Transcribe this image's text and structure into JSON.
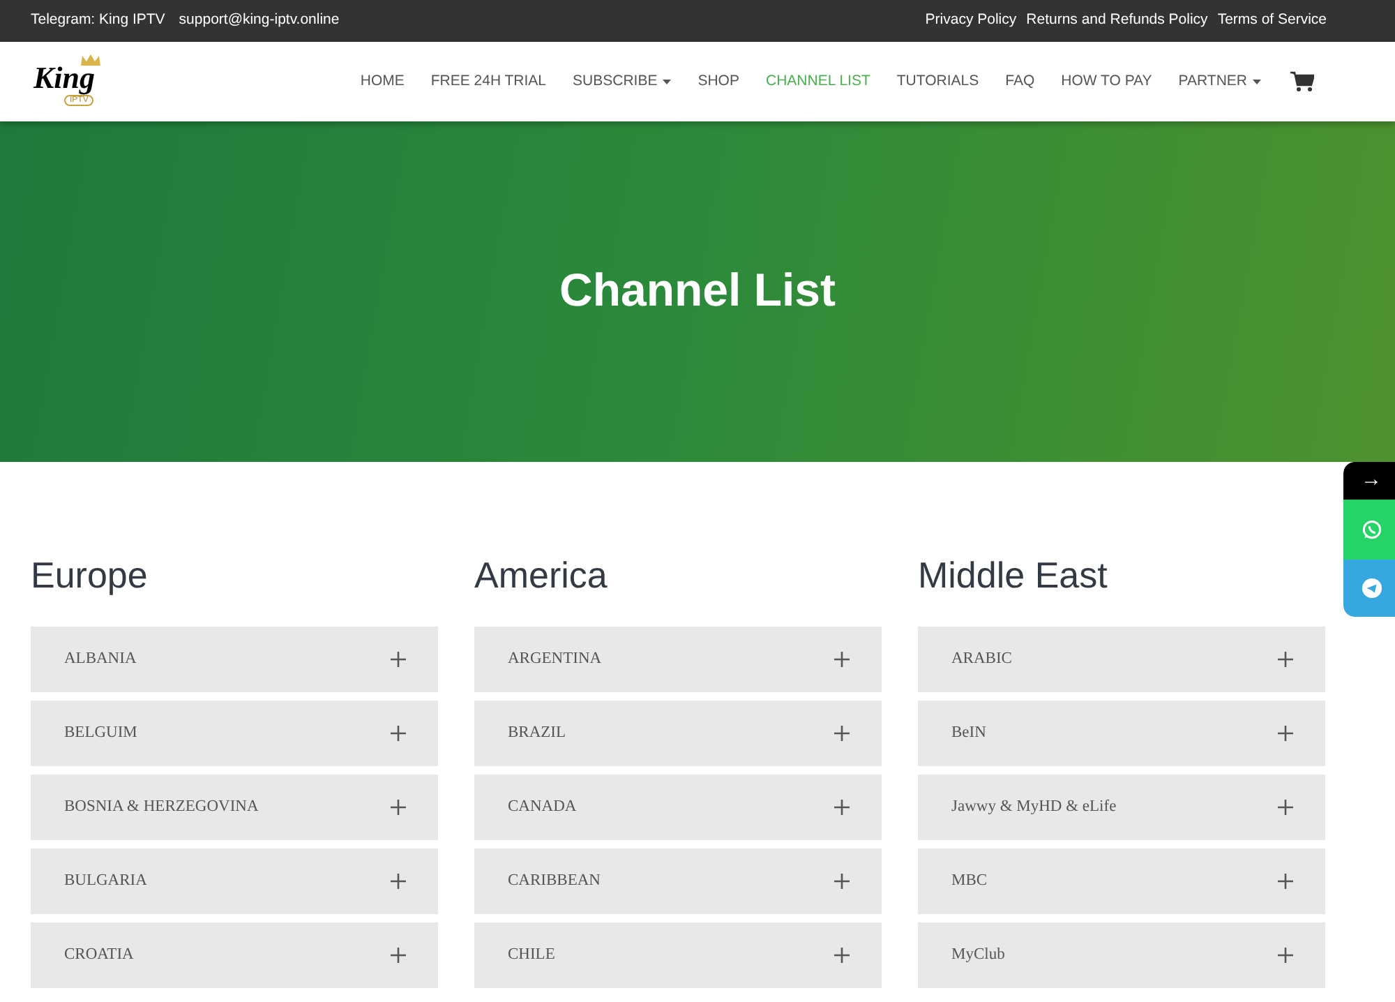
{
  "topbar": {
    "left": [
      "Telegram: King IPTV",
      "support@king-iptv.online"
    ],
    "right": [
      "Privacy Policy",
      "Returns and Refunds Policy",
      "Terms of Service"
    ]
  },
  "logo": {
    "word": "King",
    "sub": "IPTV"
  },
  "nav": [
    {
      "label": "HOME",
      "selected": false,
      "dropdown": false
    },
    {
      "label": "FREE 24H TRIAL",
      "selected": false,
      "dropdown": false
    },
    {
      "label": "SUBSCRIBE",
      "selected": false,
      "dropdown": true
    },
    {
      "label": "SHOP",
      "selected": false,
      "dropdown": false
    },
    {
      "label": "CHANNEL LIST",
      "selected": true,
      "dropdown": false
    },
    {
      "label": "TUTORIALS",
      "selected": false,
      "dropdown": false
    },
    {
      "label": "FAQ",
      "selected": false,
      "dropdown": false
    },
    {
      "label": "HOW TO PAY",
      "selected": false,
      "dropdown": false
    },
    {
      "label": "PARTNER",
      "selected": false,
      "dropdown": true
    }
  ],
  "hero": {
    "title": "Channel List"
  },
  "side_buttons": [
    {
      "kind": "arrow",
      "label": "→"
    },
    {
      "kind": "whatsapp"
    },
    {
      "kind": "telegram"
    }
  ],
  "regions": [
    {
      "title": "Europe",
      "items": [
        {
          "label": "ALBANIA",
          "expanded": false
        },
        {
          "label": "BELGUIM",
          "expanded": false
        },
        {
          "label": "BOSNIA & HERZEGOVINA",
          "expanded": false
        },
        {
          "label": "BULGARIA",
          "expanded": false
        },
        {
          "label": "CROATIA",
          "expanded": false
        }
      ]
    },
    {
      "title": "America",
      "items": [
        {
          "label": "ARGENTINA",
          "expanded": false
        },
        {
          "label": "BRAZIL",
          "expanded": false
        },
        {
          "label": "CANADA",
          "expanded": false
        },
        {
          "label": "CARIBBEAN",
          "expanded": false
        },
        {
          "label": "CHILE",
          "expanded": false
        }
      ]
    },
    {
      "title": "Middle East",
      "items": [
        {
          "label": "ARABIC",
          "expanded": false
        },
        {
          "label": "BeIN",
          "expanded": false
        },
        {
          "label": "Jawwy & MyHD & eLife",
          "expanded": false
        },
        {
          "label": "MBC",
          "expanded": false
        },
        {
          "label": "MyClub",
          "expanded": false
        }
      ]
    }
  ]
}
